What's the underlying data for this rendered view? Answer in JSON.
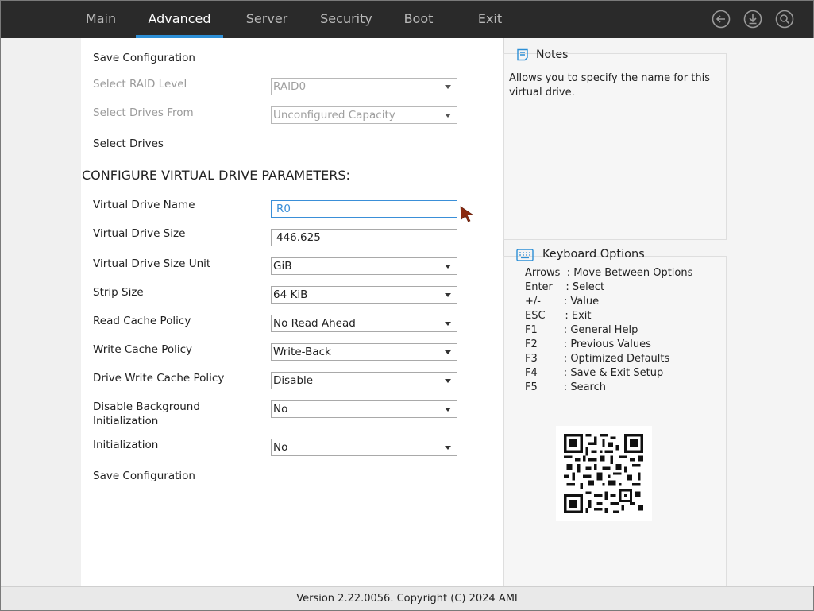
{
  "tabs": [
    {
      "label": "Main"
    },
    {
      "label": "Advanced"
    },
    {
      "label": "Server"
    },
    {
      "label": "Security"
    },
    {
      "label": "Boot"
    },
    {
      "label": "Exit"
    }
  ],
  "active_tab": "Advanced",
  "top_icons": [
    "back-arrow-icon",
    "download-icon",
    "search-icon"
  ],
  "form": {
    "save_config_top": "Save Configuration",
    "raid_level": {
      "label": "Select RAID Level",
      "value": "RAID0"
    },
    "drives_from": {
      "label": "Select Drives From",
      "value": "Unconfigured Capacity"
    },
    "select_drives": "Select Drives",
    "section_heading": "CONFIGURE VIRTUAL DRIVE PARAMETERS:",
    "vd_name": {
      "label": "Virtual Drive Name",
      "value": "R0"
    },
    "vd_size": {
      "label": "Virtual Drive Size",
      "value": "446.625"
    },
    "vd_size_unit": {
      "label": "Virtual Drive Size Unit",
      "value": "GiB"
    },
    "strip_size": {
      "label": "Strip Size",
      "value": "64 KiB"
    },
    "read_cache": {
      "label": "Read Cache Policy",
      "value": "No Read Ahead"
    },
    "write_cache": {
      "label": "Write Cache Policy",
      "value": "Write-Back"
    },
    "drive_write_cache": {
      "label": "Drive Write Cache Policy",
      "value": "Disable"
    },
    "disable_bg_init": {
      "label_line1": "Disable Background",
      "label_line2": "Initialization",
      "value": "No"
    },
    "initialization": {
      "label": "Initialization",
      "value": "No"
    },
    "save_config_bottom": "Save Configuration"
  },
  "notes": {
    "title": "Notes",
    "text": "Allows you to specify the name for this virtual drive."
  },
  "keyboard": {
    "title": "Keyboard Options",
    "rows": [
      "Arrows  : Move Between Options",
      "Enter    : Select",
      "+/-       : Value",
      "ESC      : Exit",
      "F1        : General Help",
      "F2        : Previous Values",
      "F3        : Optimized Defaults",
      "F4        : Save & Exit Setup",
      "F5        : Search"
    ]
  },
  "footer": "Version 2.22.0056. Copyright (C) 2024 AMI",
  "colors": {
    "topbar_bg": "#2a2a2a",
    "active_tab_underline": "#2d8fd6",
    "focus_blue": "#3a8fd8",
    "cursor_arrow": "#8b2a10"
  }
}
